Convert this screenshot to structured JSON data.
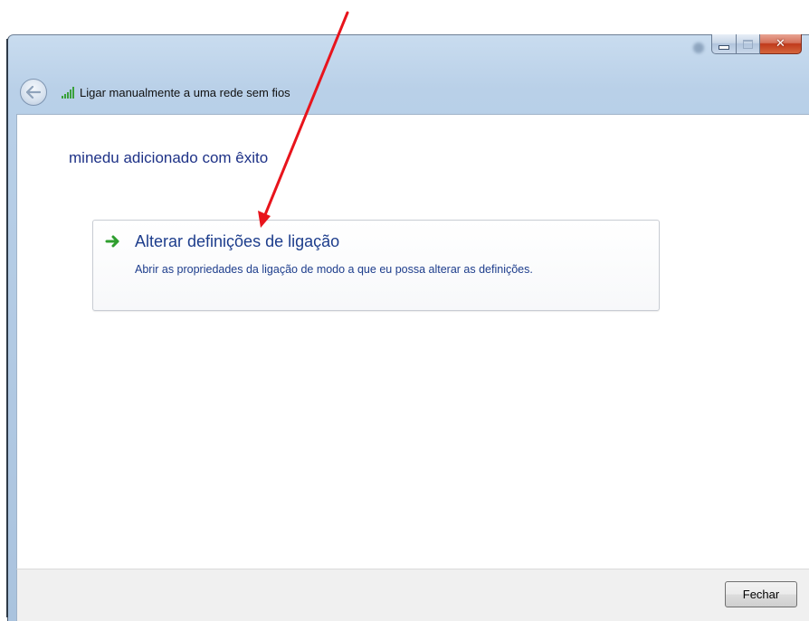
{
  "window": {
    "title": "Ligar manualmente a uma rede sem fios",
    "icon": "wireless-signal-icon",
    "caption_buttons": {
      "minimize": "minimize-icon",
      "maximize": "maximize-icon",
      "close": "close-icon"
    }
  },
  "nav": {
    "back_icon": "back-arrow-icon"
  },
  "main": {
    "headline": "minedu adicionado com êxito",
    "command_link": {
      "icon": "green-arrow-icon",
      "title": "Alterar definições de ligação",
      "description": "Abrir as propriedades da ligação de modo a que eu possa alterar as definições."
    }
  },
  "footer": {
    "close_label": "Fechar"
  },
  "colors": {
    "link_blue": "#1d3d8c",
    "headline_blue": "#1e3287",
    "annotation_red": "#e8141c",
    "arrow_green": "#2e9e2e",
    "footer_bg": "#f0f0f0"
  },
  "annotation": {
    "type": "red-arrow-pointer",
    "target": "command-link"
  }
}
